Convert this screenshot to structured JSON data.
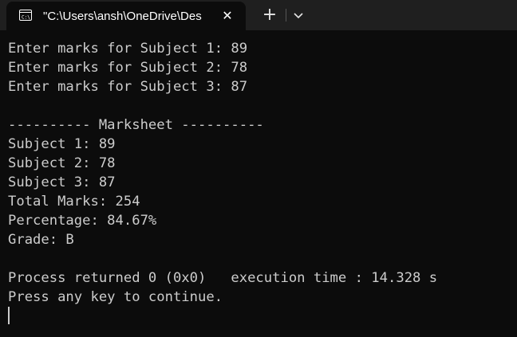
{
  "tab": {
    "title": "\"C:\\Users\\ansh\\OneDrive\\Des",
    "icon": "terminal-icon",
    "close_icon": "close-icon",
    "new_tab_label": "+",
    "dropdown_icon": "chevron-down-icon"
  },
  "console": {
    "lines": [
      "Enter marks for Subject 1: 89",
      "Enter marks for Subject 2: 78",
      "Enter marks for Subject 3: 87",
      "",
      "---------- Marksheet ----------",
      "Subject 1: 89",
      "Subject 2: 78",
      "Subject 3: 87",
      "Total Marks: 254",
      "Percentage: 84.67%",
      "Grade: B",
      "",
      "Process returned 0 (0x0)   execution time : 14.328 s",
      "Press any key to continue."
    ]
  },
  "colors": {
    "background": "#0c0c0c",
    "tabbar": "#1f1f1f",
    "text": "#cccccc"
  }
}
